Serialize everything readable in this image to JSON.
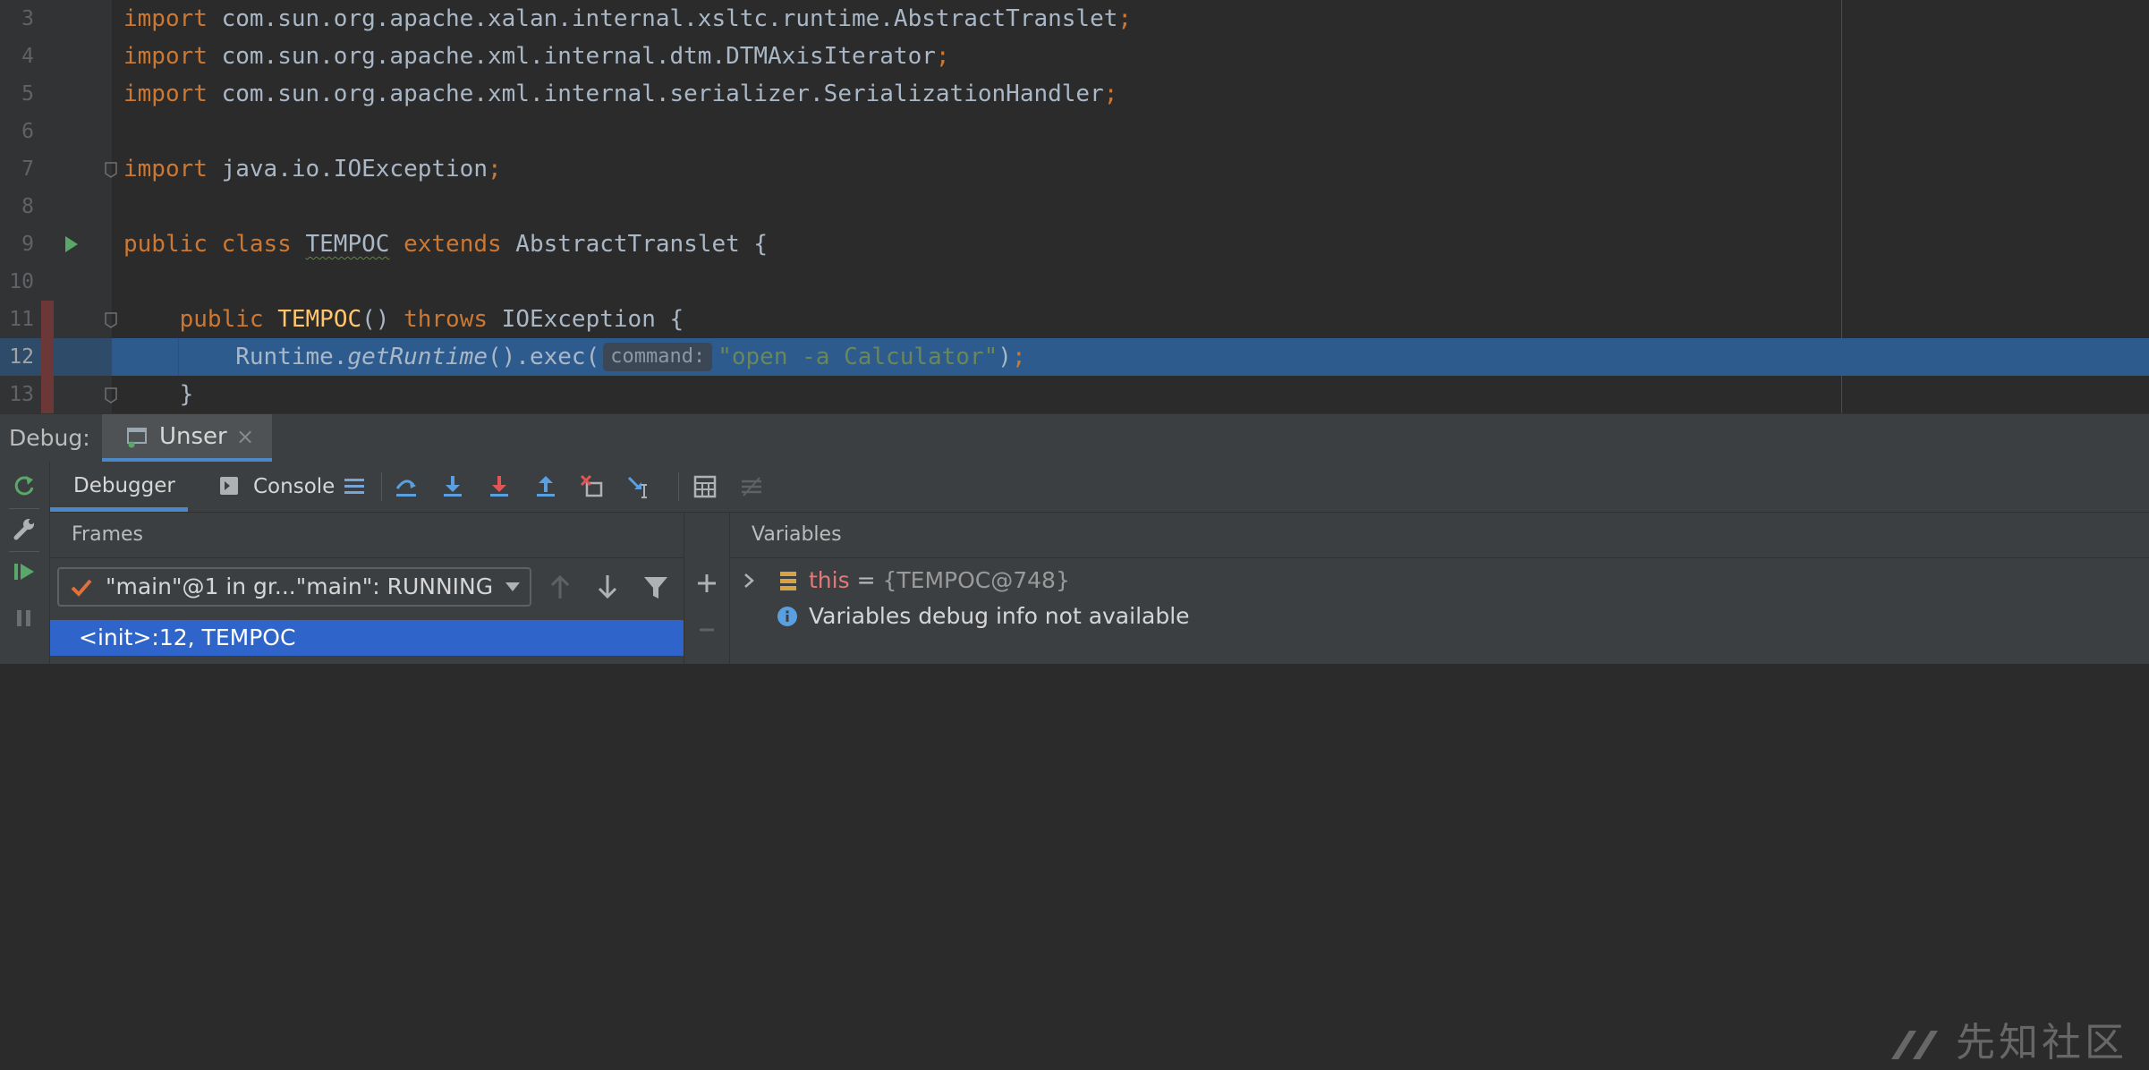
{
  "editor": {
    "lines": [
      {
        "num": "3",
        "tokens": [
          {
            "t": "import",
            "c": "kw"
          },
          {
            "t": " com.sun.org.apache.xalan.internal.xsltc.runtime.AbstractTranslet"
          },
          {
            "t": ";",
            "c": "kw"
          }
        ]
      },
      {
        "num": "4",
        "tokens": [
          {
            "t": "import",
            "c": "kw"
          },
          {
            "t": " com.sun.org.apache.xml.internal.dtm.DTMAxisIterator"
          },
          {
            "t": ";",
            "c": "kw"
          }
        ]
      },
      {
        "num": "5",
        "tokens": [
          {
            "t": "import",
            "c": "kw"
          },
          {
            "t": " com.sun.org.apache.xml.internal.serializer.SerializationHandler"
          },
          {
            "t": ";",
            "c": "kw"
          }
        ]
      },
      {
        "num": "6",
        "tokens": []
      },
      {
        "num": "7",
        "fold": true,
        "tokens": [
          {
            "t": "import",
            "c": "kw"
          },
          {
            "t": " java.io.IOException"
          },
          {
            "t": ";",
            "c": "kw"
          }
        ]
      },
      {
        "num": "8",
        "tokens": []
      },
      {
        "num": "9",
        "run": true,
        "tokens": [
          {
            "t": "public class ",
            "c": "kw"
          },
          {
            "t": "TEMPOC",
            "c": "sq"
          },
          {
            "t": " "
          },
          {
            "t": "extends",
            "c": "kw"
          },
          {
            "t": " AbstractTranslet {"
          }
        ]
      },
      {
        "num": "10",
        "tokens": []
      },
      {
        "num": "11",
        "bp": true,
        "fold": true,
        "tokens": [
          {
            "t": "    "
          },
          {
            "t": "public",
            "c": "kw"
          },
          {
            "t": " "
          },
          {
            "t": "TEMPOC",
            "c": "fn"
          },
          {
            "t": "() "
          },
          {
            "t": "throws",
            "c": "kw"
          },
          {
            "t": " IOException {"
          }
        ]
      },
      {
        "num": "12",
        "bp": true,
        "hl": true,
        "guide": true,
        "tokens": [
          {
            "t": "        Runtime."
          },
          {
            "t": "getRuntime",
            "c": "it"
          },
          {
            "t": "().exec("
          },
          {
            "t": "command:",
            "c": "hint"
          },
          {
            "t": "\"open -a Calculator\"",
            "c": "str"
          },
          {
            "t": ")"
          },
          {
            "t": ";",
            "c": "kw"
          }
        ]
      },
      {
        "num": "13",
        "bp": true,
        "fold": true,
        "tokens": [
          {
            "t": "    }"
          }
        ]
      }
    ]
  },
  "debug": {
    "label": "Debug:",
    "session_tab": "Unser",
    "close_glyph": "×",
    "tabs": {
      "debugger": "Debugger",
      "console": "Console"
    },
    "frames": {
      "title": "Frames",
      "thread": "\"main\"@1 in gr...\"main\": RUNNING",
      "selected_frame": "<init>:12, TEMPOC"
    },
    "variables": {
      "title": "Variables",
      "this_name": "this",
      "this_eq": " = ",
      "this_value": "{TEMPOC@748}",
      "info": "Variables debug info not available"
    }
  },
  "watermark": {
    "text": "先知社区"
  },
  "colors": {
    "editor_bg": "#2b2b2b",
    "gutter_bg": "#313335",
    "keyword": "#cc7832",
    "string": "#6a8759",
    "method_decl": "#ffc66d",
    "execution_line": "#2e5b8e",
    "selection": "#2f65ca",
    "panel_bg": "#3c3f41",
    "accent": "#4a88c7"
  },
  "icons": {
    "rerun": "rerun-icon",
    "settings": "wrench-icon",
    "resume": "resume-icon",
    "pause": "pause-icon",
    "step_over": "step-over-icon",
    "step_into": "step-into-icon",
    "force_step_into": "force-step-into-icon",
    "step_out": "step-out-icon",
    "drop_frame": "drop-frame-icon",
    "run_to_cursor": "run-to-cursor-icon",
    "evaluate": "evaluate-expression-icon",
    "trace": "trace-icon"
  }
}
